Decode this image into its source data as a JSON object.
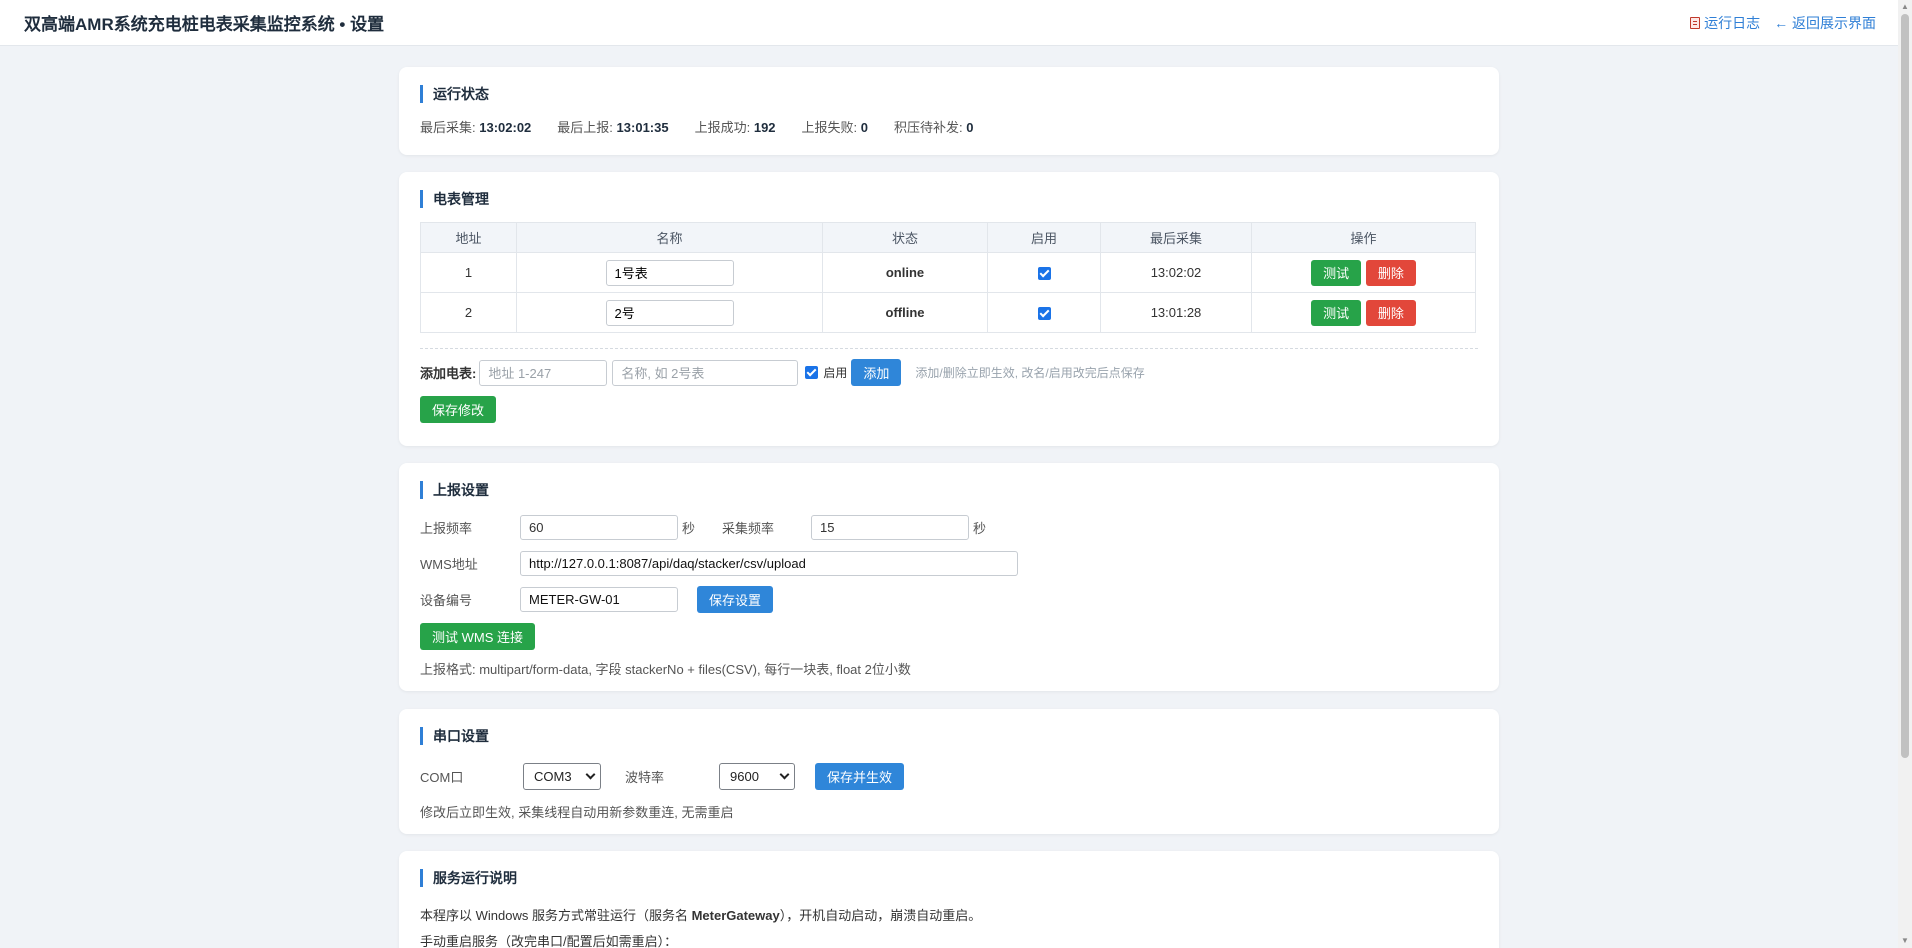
{
  "header": {
    "title": "双高端AMR系统充电桩电表采集监控系统 • 设置",
    "log_link": "运行日志",
    "back_link": "← 返回展示界面"
  },
  "status": {
    "title": "运行状态",
    "last_collect_label": "最后采集:",
    "last_collect": "13:02:02",
    "last_report_label": "最后上报:",
    "last_report": "13:01:35",
    "report_ok_label": "上报成功:",
    "report_ok": "192",
    "report_fail_label": "上报失败:",
    "report_fail": "0",
    "backlog_label": "积压待补发:",
    "backlog": "0"
  },
  "meters": {
    "title": "电表管理",
    "columns": [
      "地址",
      "名称",
      "状态",
      "启用",
      "最后采集",
      "操作"
    ],
    "rows": [
      {
        "address": "1",
        "name": "1号表",
        "status": "online",
        "enabled": true,
        "last": "13:02:02"
      },
      {
        "address": "2",
        "name": "2号",
        "status": "offline",
        "enabled": true,
        "last": "13:01:28"
      }
    ],
    "test_label": "测试",
    "delete_label": "删除",
    "add_label": "添加电表:",
    "addr_placeholder": "地址 1-247",
    "name_placeholder": "名称, 如 2号表",
    "enable_label": "启用",
    "add_button": "添加",
    "add_hint": "添加/删除立即生效, 改名/启用改完后点保存",
    "save_button": "保存修改"
  },
  "report": {
    "title": "上报设置",
    "report_freq_label": "上报频率",
    "report_freq": "60",
    "sec": "秒",
    "collect_freq_label": "采集频率",
    "collect_freq": "15",
    "wms_label": "WMS地址",
    "wms_url": "http://127.0.0.1:8087/api/daq/stacker/csv/upload",
    "device_label": "设备编号",
    "device_id": "METER-GW-01",
    "save_button": "保存设置",
    "test_button": "测试 WMS 连接",
    "hint": "上报格式: multipart/form-data, 字段 stackerNo + files(CSV), 每行一块表, float 2位小数"
  },
  "serial": {
    "title": "串口设置",
    "com_label": "COM口",
    "com_value": "COM3",
    "baud_label": "波特率",
    "baud_value": "9600",
    "save_button": "保存并生效",
    "hint": "修改后立即生效, 采集线程自动用新参数重连, 无需重启"
  },
  "service": {
    "title": "服务运行说明",
    "line1_a": "本程序以 Windows 服务方式常驻运行（服务名 ",
    "line1_name": "MeterGateway",
    "line1_b": "），开机自动启动，崩溃自动重启。",
    "line2": "手动重启服务（改完串口/配置后如需重启）："
  },
  "colors": {
    "accent": "#2f7fd6",
    "green": "#27a349",
    "red": "#e2473a",
    "background": "#f0f3f7"
  }
}
